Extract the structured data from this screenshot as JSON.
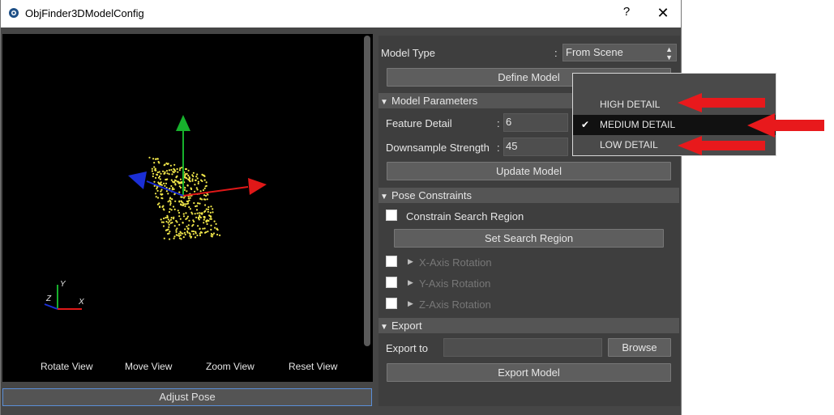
{
  "window": {
    "title": "ObjFinder3DModelConfig",
    "help_label": "?",
    "close_label": "✕"
  },
  "viewport": {
    "axis_labels": {
      "y": "Y",
      "z": "Z",
      "x": "X"
    },
    "buttons": [
      "Rotate View",
      "Move View",
      "Zoom View",
      "Reset View"
    ]
  },
  "adjust_pose_label": "Adjust Pose",
  "model": {
    "type_label": "Model Type",
    "type_value": "From Scene",
    "define_label": "Define Model"
  },
  "model_parameters": {
    "header": "Model Parameters",
    "feature_detail_label": "Feature Detail",
    "feature_detail_value": "6",
    "downsample_label": "Downsample Strength",
    "downsample_value": "45",
    "update_label": "Update Model"
  },
  "pose_constraints": {
    "header": "Pose Constraints",
    "constrain_label": "Constrain Search Region",
    "set_region_label": "Set Search Region",
    "x_rotation": "X-Axis Rotation",
    "y_rotation": "Y-Axis Rotation",
    "z_rotation": "Z-Axis Rotation"
  },
  "export": {
    "header": "Export",
    "export_to_label": "Export to",
    "export_path": "",
    "browse_label": "Browse",
    "export_model_label": "Export Model"
  },
  "dropdown": {
    "items": [
      {
        "label": "HIGH DETAIL",
        "selected": false
      },
      {
        "label": "MEDIUM DETAIL",
        "selected": true
      },
      {
        "label": "LOW DETAIL",
        "selected": false
      }
    ],
    "check_mark": "✔"
  },
  "colors": {
    "annotation_arrow": "#e8191c",
    "point_cloud": "#f2e84a",
    "axis_x": "#e01818",
    "axis_y": "#17b12c",
    "axis_z": "#1b2fd6"
  }
}
